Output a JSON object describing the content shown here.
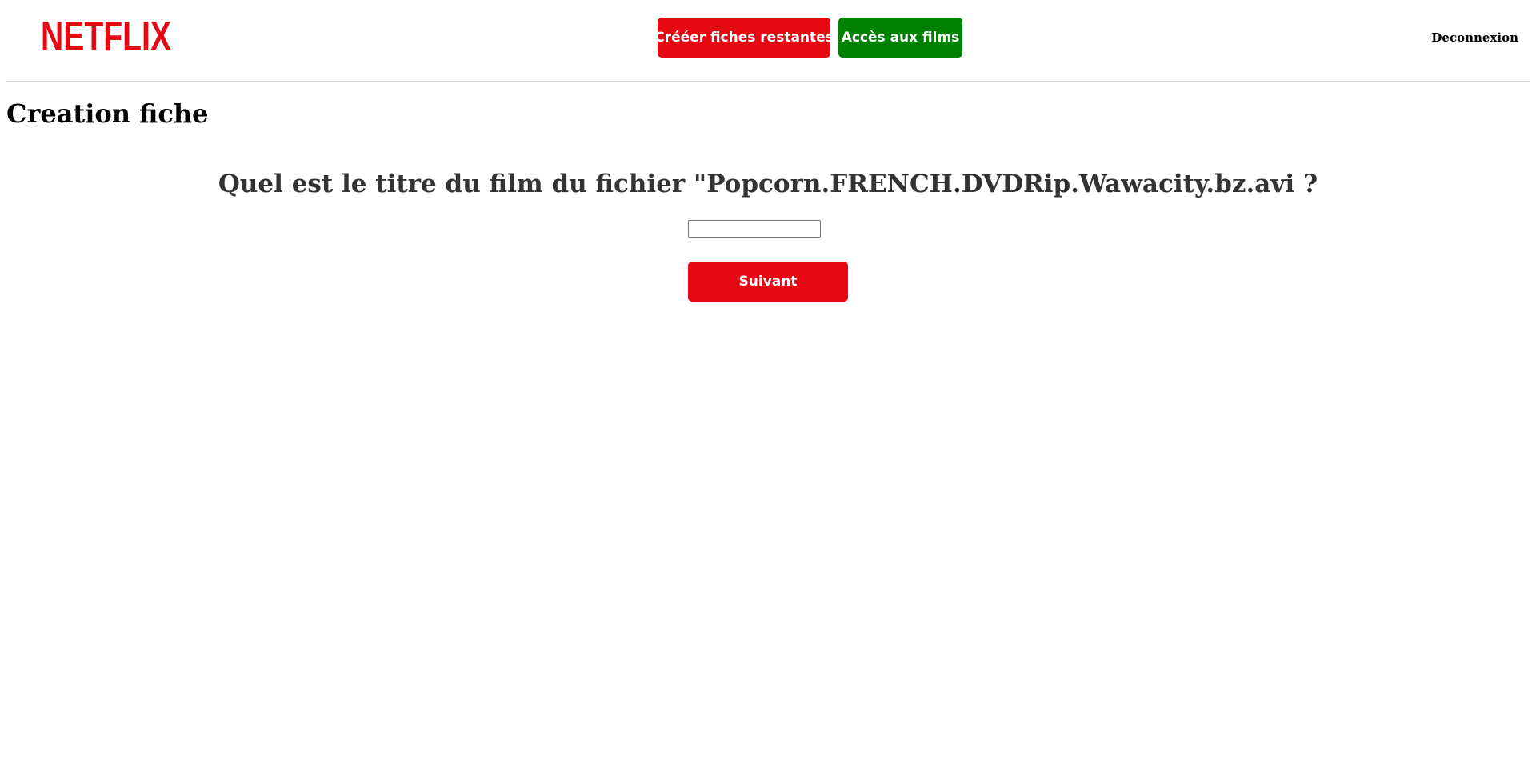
{
  "header": {
    "logo_text": "NETFLIX",
    "create_button_label": "Crééer fiches restantes",
    "films_button_label": "Accès aux films",
    "logout_label": "Deconnexion"
  },
  "main": {
    "page_title": "Creation fiche",
    "question": "Quel est le titre du film du fichier \"Popcorn.FRENCH.DVDRip.Wawacity.bz.avi ?",
    "answer_input": {
      "value": "",
      "placeholder": ""
    },
    "next_button_label": "Suivant"
  },
  "colors": {
    "brand_red": "#e50914",
    "green": "#008000",
    "question_text": "#333333"
  }
}
